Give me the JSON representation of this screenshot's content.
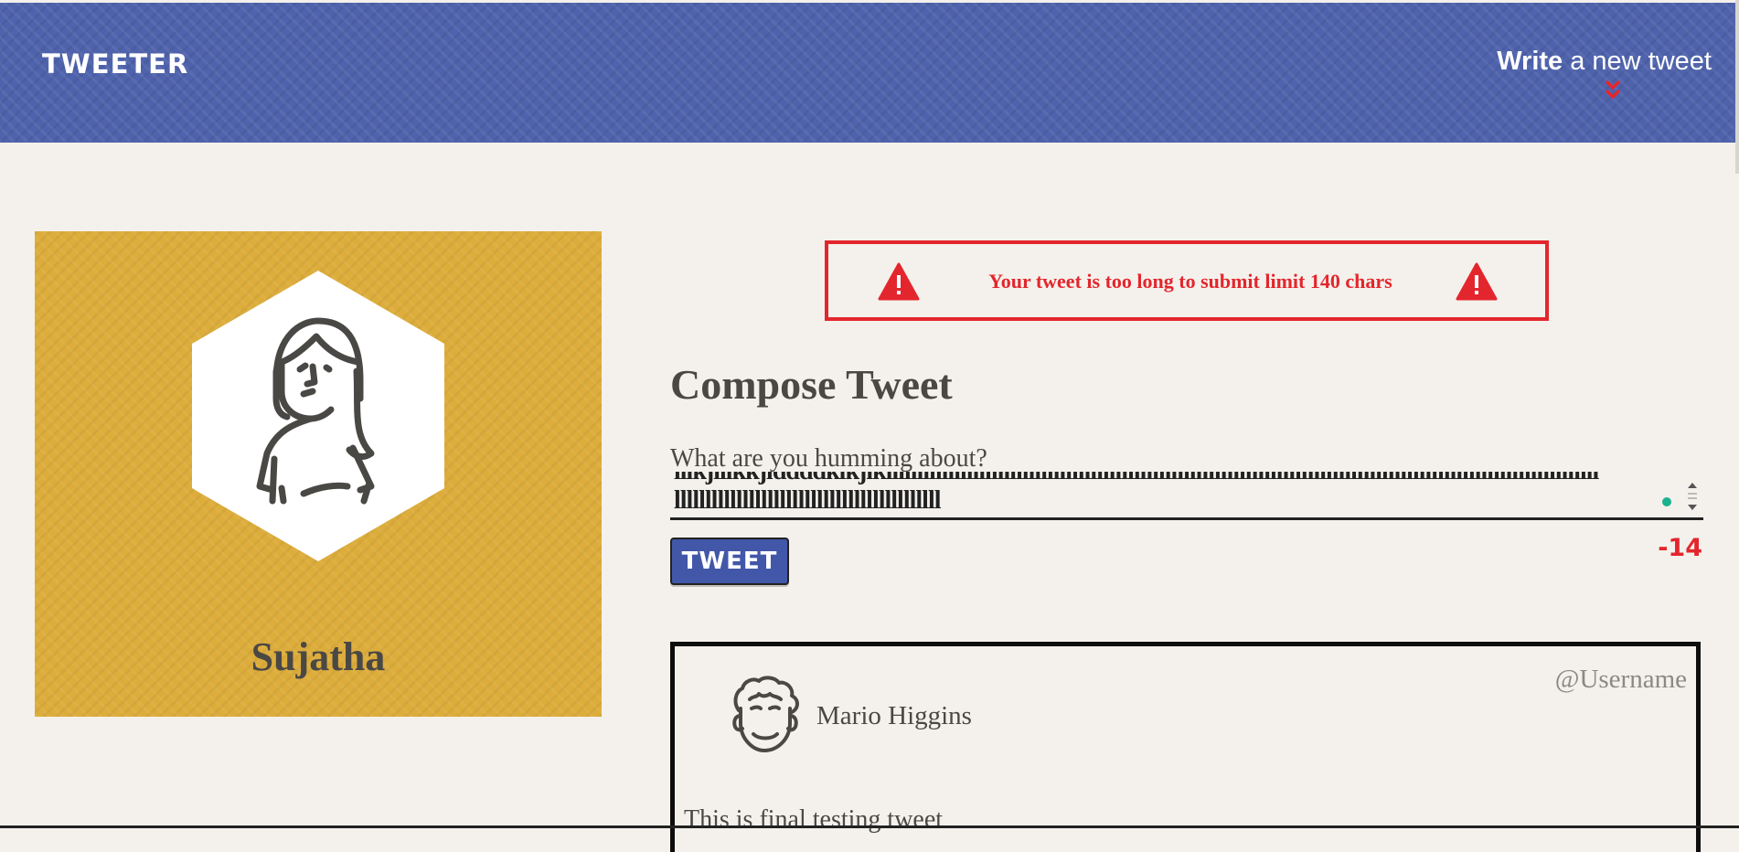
{
  "nav": {
    "brand": "TWEETER",
    "write_bold": "Write",
    "write_rest": " a new tweet"
  },
  "profile": {
    "name": "Sujatha"
  },
  "error": {
    "message": "Your tweet is too long to submit limit 140 chars"
  },
  "compose": {
    "title": "Compose Tweet",
    "label": "What are you humming about?",
    "text_line1": "lllkjlllkkjlddddklkjlklllllllllllllllllllllllllllllllllllllllllllllllllllllllllllllllllllllllllllllllllllllllllllllllllllllllllllllllllll",
    "text_line2": "lllllllllllllllllllllllllllllllllllllllllll",
    "button_label": "TWEET",
    "counter": "-14"
  },
  "tweet": {
    "name": "Mario Higgins",
    "handle": "@Username",
    "body": "This is final testing tweet"
  }
}
